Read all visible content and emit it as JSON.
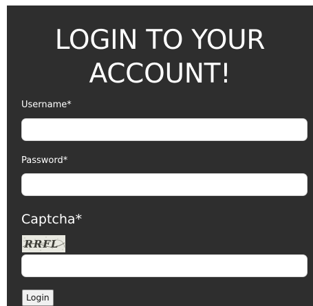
{
  "form": {
    "title_line1": "LOGIN TO YOUR",
    "title_line2": "ACCOUNT!",
    "username_label": "Username",
    "username_value": "",
    "password_label": "Password",
    "password_value": "",
    "captcha_label": "Captcha",
    "captcha_value": "",
    "captcha_image_text": "RRFL",
    "required_marker": "*",
    "login_label": "Login"
  },
  "colors": {
    "panel_background": "#2e2e2e",
    "text": "#ffffff",
    "input_background": "#ffffff",
    "button_background": "#f0f0f0"
  }
}
